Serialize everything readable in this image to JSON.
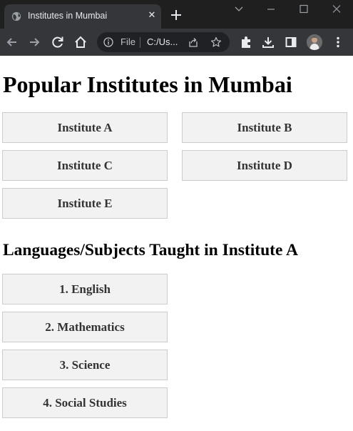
{
  "browser": {
    "tab_title": "Institutes in Mumbai",
    "address_scheme": "File",
    "address_url": "C:/Us..."
  },
  "page": {
    "title": "Popular Institutes in Mumbai",
    "institutes": [
      "Institute A",
      "Institute B",
      "Institute C",
      "Institute D",
      "Institute E"
    ],
    "subjects_heading": "Languages/Subjects Taught in Institute A",
    "subjects": [
      "1. English",
      "2. Mathematics",
      "3. Science",
      "4. Social Studies"
    ]
  },
  "colors": {
    "card_background": "#f2f2f2",
    "card_border": "#cccccc",
    "card_text": "#333333"
  }
}
